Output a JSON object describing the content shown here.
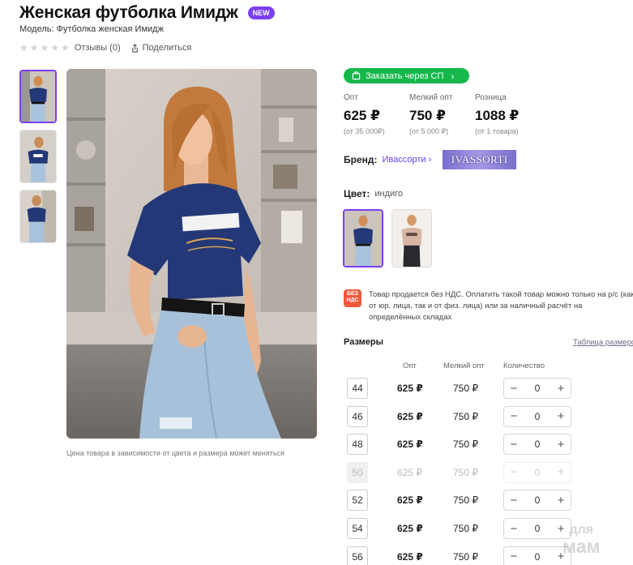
{
  "product": {
    "title": "Женская футболка Имидж",
    "badge": "NEW",
    "model": "Модель: Футболка женская Имидж",
    "reviews": "Отзывы (0)",
    "share": "Поделиться",
    "photo_caption": "Цена товара в зависимости от цвета и размера может меняться"
  },
  "order": {
    "sp_button": "Заказать через СП"
  },
  "prices": [
    {
      "label": "Опт",
      "value": "625 ₽",
      "note": "(от 35 000₽)"
    },
    {
      "label": "Мелкий опт",
      "value": "750 ₽",
      "note": "(от 5 000 ₽)"
    },
    {
      "label": "Розница",
      "value": "1088 ₽",
      "note": "(от 1 товара)"
    }
  ],
  "brand": {
    "label": "Бренд:",
    "name": "Ивассорти",
    "logo_text": "IVASSORTI"
  },
  "color": {
    "label": "Цвет:",
    "value": "индиго"
  },
  "vat": {
    "icon_text": "БЕЗ НДС",
    "text": "Товар продается без НДС. Оплатить такой товар можно только на р/с (как от юр. лица, так и от физ. лица) или за наличный расчёт на определённых складах"
  },
  "sizes": {
    "heading": "Размеры",
    "table_link": "Таблица размеров",
    "columns": {
      "opt": "Опт",
      "small_opt": "Мелкий опт",
      "qty": "Количество"
    },
    "rows": [
      {
        "size": "44",
        "opt": "625 ₽",
        "small": "750 ₽",
        "qty": "0",
        "available": true
      },
      {
        "size": "46",
        "opt": "625 ₽",
        "small": "750 ₽",
        "qty": "0",
        "available": true
      },
      {
        "size": "48",
        "opt": "625 ₽",
        "small": "750 ₽",
        "qty": "0",
        "available": true
      },
      {
        "size": "50",
        "opt": "625 ₽",
        "small": "750 ₽",
        "qty": "0",
        "available": false
      },
      {
        "size": "52",
        "opt": "625 ₽",
        "small": "750 ₽",
        "qty": "0",
        "available": true
      },
      {
        "size": "54",
        "opt": "625 ₽",
        "small": "750 ₽",
        "qty": "0",
        "available": true
      },
      {
        "size": "56",
        "opt": "625 ₽",
        "small": "750 ₽",
        "qty": "0",
        "available": true
      }
    ]
  },
  "stepper": {
    "minus": "−",
    "plus": "+"
  },
  "watermark": {
    "line1": "для",
    "line2": "мам"
  },
  "colors": {
    "accent": "#7b3ff2",
    "green": "#16b84c",
    "shirt": "#243877",
    "vat": "#ef5a3b"
  }
}
